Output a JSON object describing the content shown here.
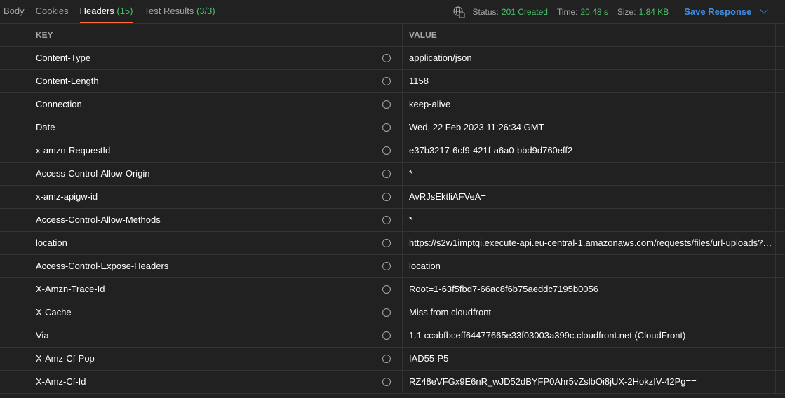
{
  "tabs": [
    {
      "label": "Body",
      "count": ""
    },
    {
      "label": "Cookies",
      "count": ""
    },
    {
      "label": "Headers",
      "count": "(15)"
    },
    {
      "label": "Test Results",
      "count": "(3/3)"
    }
  ],
  "active_tab": "Headers",
  "status": {
    "status_label": "Status:",
    "status_value": "201 Created",
    "time_label": "Time:",
    "time_value": "20.48 s",
    "size_label": "Size:",
    "size_value": "1.84 KB",
    "save_label": "Save Response"
  },
  "table": {
    "key_header": "KEY",
    "value_header": "VALUE",
    "rows": [
      {
        "key": "Content-Type",
        "value": "application/json"
      },
      {
        "key": "Content-Length",
        "value": "1158"
      },
      {
        "key": "Connection",
        "value": "keep-alive"
      },
      {
        "key": "Date",
        "value": "Wed, 22 Feb 2023 11:26:34 GMT"
      },
      {
        "key": "x-amzn-RequestId",
        "value": "e37b3217-6cf9-421f-a6a0-bbd9d760eff2"
      },
      {
        "key": "Access-Control-Allow-Origin",
        "value": "*"
      },
      {
        "key": "x-amz-apigw-id",
        "value": "AvRJsEktliAFVeA="
      },
      {
        "key": "Access-Control-Allow-Methods",
        "value": "*"
      },
      {
        "key": "location",
        "value": "https://s2w1imptqi.execute-api.eu-central-1.amazonaws.com/requests/files/url-uploads?f..."
      },
      {
        "key": "Access-Control-Expose-Headers",
        "value": "location"
      },
      {
        "key": "X-Amzn-Trace-Id",
        "value": "Root=1-63f5fbd7-66ac8f6b75aeddc7195b0056"
      },
      {
        "key": "X-Cache",
        "value": "Miss from cloudfront"
      },
      {
        "key": "Via",
        "value": "1.1 ccabfbceff64477665e33f03003a399c.cloudfront.net (CloudFront)"
      },
      {
        "key": "X-Amz-Cf-Pop",
        "value": "IAD55-P5"
      },
      {
        "key": "X-Amz-Cf-Id",
        "value": "RZ48eVFGx9E6nR_wJD52dBYFP0Ahr5vZslbOi8jUX-2HokzIV-42Pg=="
      }
    ]
  },
  "colors": {
    "accent_tab": "#ff6c37",
    "success": "#4cbf6b",
    "link": "#3d8fe8",
    "background": "#212121"
  },
  "icons": {
    "network": "globe-network-icon",
    "info": "info-icon",
    "dropdown": "chevron-down-icon"
  }
}
